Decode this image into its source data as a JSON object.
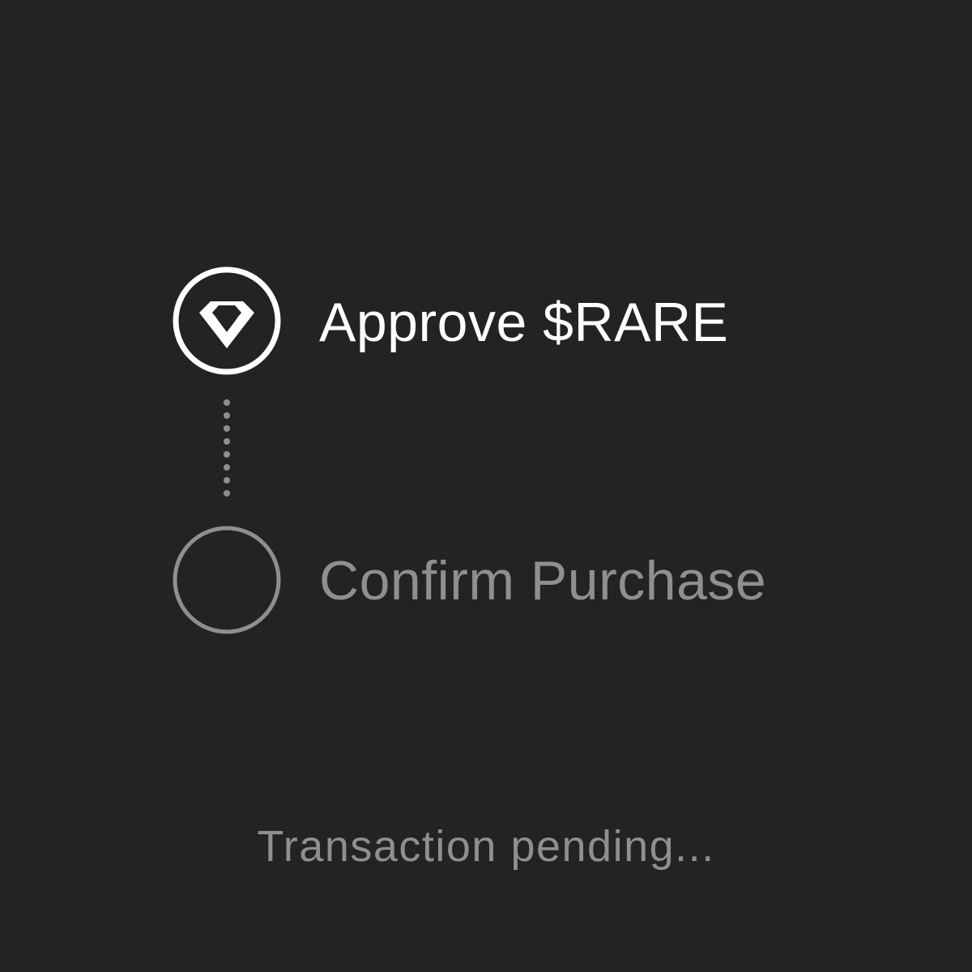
{
  "steps": [
    {
      "label": "Approve $RARE",
      "state": "active",
      "icon": "diamond-icon"
    },
    {
      "label": "Confirm Purchase",
      "state": "pending",
      "icon": "empty-circle-icon"
    }
  ],
  "status": {
    "text": "Transaction pending..."
  },
  "colors": {
    "background": "#232323",
    "active": "#ffffff",
    "inactive": "#8f8f8f",
    "connector": "#8f8f8f"
  }
}
